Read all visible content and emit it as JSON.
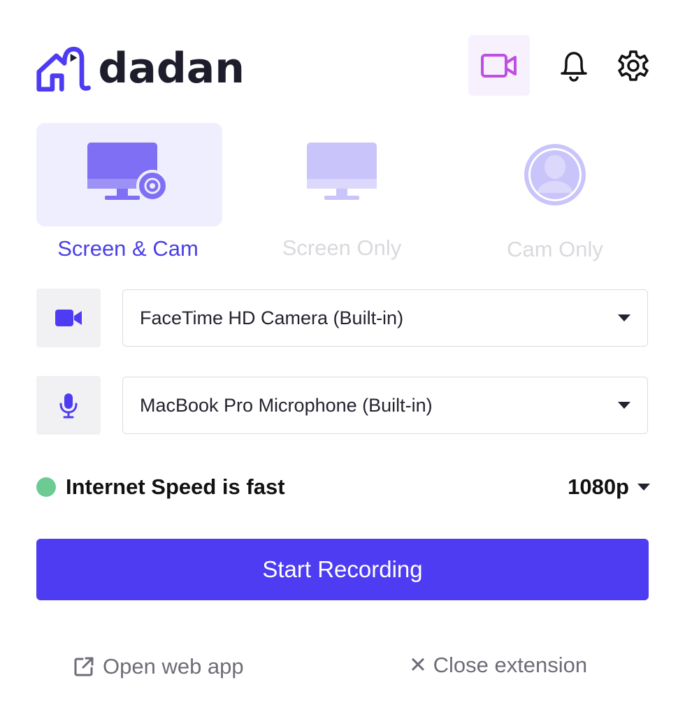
{
  "header": {
    "brand": "dadan",
    "icons": {
      "logo": "dadan-logo-icon",
      "camera": "video-camera-icon",
      "bell": "bell-icon",
      "settings": "gear-icon"
    }
  },
  "modes": [
    {
      "label": "Screen & Cam",
      "icon": "monitor-with-cam-icon",
      "selected": true
    },
    {
      "label": "Screen Only",
      "icon": "monitor-icon",
      "selected": false
    },
    {
      "label": "Cam Only",
      "icon": "user-avatar-icon",
      "selected": false
    }
  ],
  "devices": {
    "camera": {
      "value": "FaceTime HD Camera (Built-in)",
      "icon": "video-camera-icon"
    },
    "microphone": {
      "value": "MacBook Pro Microphone (Built-in)",
      "icon": "microphone-icon"
    }
  },
  "status": {
    "speed": "Internet Speed is fast",
    "quality": "1080p"
  },
  "actions": {
    "start": "Start Recording",
    "open_web": "Open web app",
    "close_ext": "✕ Close extension"
  },
  "colors": {
    "brand": "#4e3cf2",
    "mode_active_bg": "#efeefe",
    "mode_active_text": "#4a3fe6",
    "mode_inactive_text": "#d9d9de",
    "status_dot": "#6ccb92",
    "camera_toggle": "#c04ee0"
  }
}
